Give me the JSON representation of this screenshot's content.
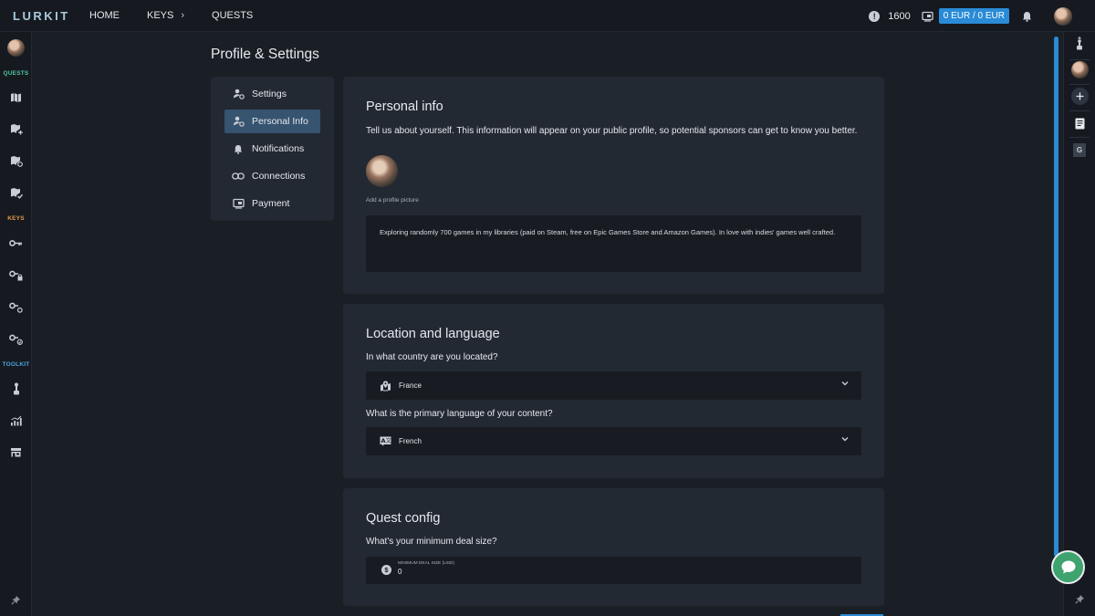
{
  "app": {
    "logo_text": "LURKIT",
    "accent_color": "#2a8bd6",
    "background_color": "#1a1f26",
    "panel_color": "#232932"
  },
  "topnav": {
    "items": [
      {
        "label": "HOME"
      },
      {
        "label": "KEYS",
        "has_chevron": true,
        "chevron": "›"
      },
      {
        "label": "QUESTS"
      }
    ]
  },
  "header_right": {
    "coin_icon": "coin-icon",
    "coin_symbol": "!",
    "coins": "1600",
    "wallet_icon": "wallet-icon",
    "balance": "0 EUR / 0 EUR",
    "bell_icon": "bell-icon",
    "avatar_icon": "user-avatar"
  },
  "left_sidebar": {
    "sections": [
      {
        "label": "QUESTS",
        "color": "#4fc3a1",
        "icons": [
          "quest-map-icon",
          "quest-add-icon",
          "quest-refresh-icon",
          "quest-check-icon"
        ]
      },
      {
        "label": "KEYS",
        "color": "#e39a4a",
        "icons": [
          "key-icon",
          "key-lock-icon",
          "key-refresh-icon",
          "key-check-icon"
        ]
      },
      {
        "label": "TOOLKIT",
        "color": "#4aa3e3",
        "icons": [
          "joystick-icon",
          "analytics-icon",
          "store-icon"
        ]
      }
    ],
    "pin_icon": "pin-icon"
  },
  "page": {
    "title": "Profile & Settings"
  },
  "settings_nav": {
    "items": [
      {
        "label": "Settings",
        "icon": "user-gear-icon",
        "active": false
      },
      {
        "label": "Personal Info",
        "icon": "user-gear-icon",
        "active": true
      },
      {
        "label": "Notifications",
        "icon": "bell-icon",
        "active": false
      },
      {
        "label": "Connections",
        "icon": "link-icon",
        "active": false
      },
      {
        "label": "Payment",
        "icon": "payment-icon",
        "active": false
      }
    ]
  },
  "personal_info": {
    "title": "Personal info",
    "description": "Tell us about yourself. This information will appear on your public profile, so potential sponsors can get to know you better.",
    "add_picture_label": "Add a profile picture",
    "bio": "Exploring randomly 700 games in my libraries (paid on Steam, free on Epic Games Store and Amazon Games). In love with indies' games well crafted."
  },
  "location": {
    "title": "Location and language",
    "country_question": "In what country are you located?",
    "country_value": "France",
    "country_icon": "map-pin-icon",
    "language_question": "What is the primary language of your content?",
    "language_value": "French",
    "language_icon": "translate-icon"
  },
  "quest_config": {
    "title": "Quest config",
    "deal_question": "What's your minimum deal size?",
    "deal_label": "MINIMUM DEAL SIZE (USD)",
    "deal_value": "0",
    "deal_icon": "dollar-icon",
    "deal_symbol": "$"
  },
  "right_sidebar": {
    "icons": [
      "joystick-icon",
      "user-avatar",
      "add-icon",
      "document-icon",
      "g-badge-icon",
      "pin-icon"
    ],
    "g_badge_text": "G"
  },
  "chat": {
    "icon": "chat-bubble-icon",
    "color": "#3ea36f"
  }
}
